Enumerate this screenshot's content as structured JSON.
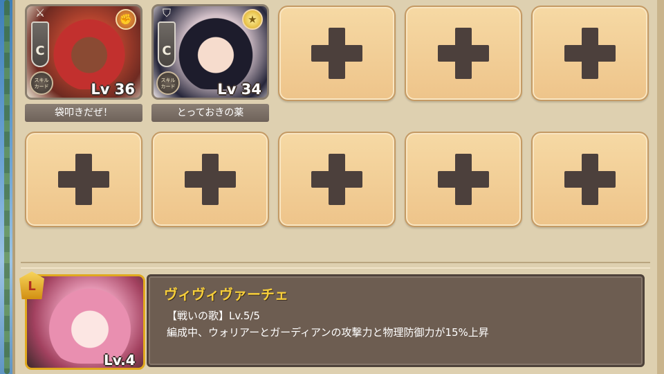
{
  "party": {
    "members": [
      {
        "class_badge": "C",
        "role_icon": "crossed-swords-icon",
        "element_icon": "fire-icon",
        "skill_badge": "スキル\nカード",
        "level": "Lv 36",
        "skill_name": "袋叩きだぜ！"
      },
      {
        "class_badge": "C",
        "role_icon": "shield-icon",
        "element_icon": "star-icon",
        "skill_badge": "スキル\nカード",
        "level": "Lv 34",
        "skill_name": "とっておきの薬"
      }
    ],
    "empty_slot_count": 8
  },
  "leader": {
    "rank_badge": "L",
    "level": "Lv.4",
    "name": "ヴィヴィヴァーチェ",
    "skill": "【戦いの歌】Lv.5/5",
    "description": "編成中、ウォリアーとガーディアンの攻撃力と物理防御力が15%上昇"
  },
  "colors": {
    "leader_name": "#f7cf3a",
    "slot_fill": "#f2cc92",
    "plus": "#4c403c"
  }
}
